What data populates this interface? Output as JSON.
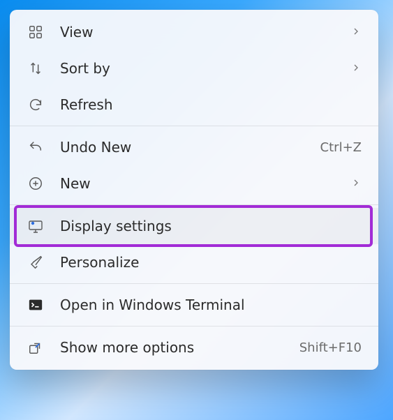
{
  "menu": {
    "items": [
      {
        "label": "View",
        "hasSubmenu": true
      },
      {
        "label": "Sort by",
        "hasSubmenu": true
      },
      {
        "label": "Refresh"
      },
      {
        "label": "Undo New",
        "shortcut": "Ctrl+Z"
      },
      {
        "label": "New",
        "hasSubmenu": true
      },
      {
        "label": "Display settings"
      },
      {
        "label": "Personalize"
      },
      {
        "label": "Open in Windows Terminal"
      },
      {
        "label": "Show more options",
        "shortcut": "Shift+F10"
      }
    ]
  },
  "highlightColor": "#a22bd6"
}
